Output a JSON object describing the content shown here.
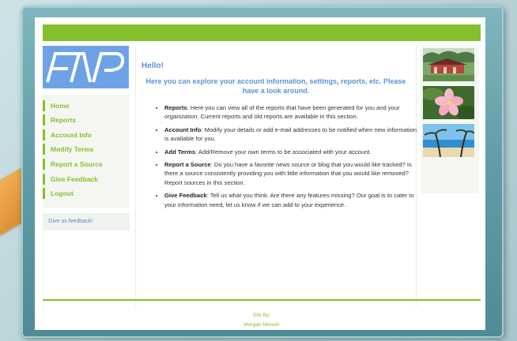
{
  "greeting": "Hello!",
  "intro": "Here you can explore your account information, settings, reports, etc. Please have a look around.",
  "logo_text": "FIP",
  "nav": [
    {
      "label": "Home"
    },
    {
      "label": "Reports"
    },
    {
      "label": "Account Info"
    },
    {
      "label": "Modify Terms"
    },
    {
      "label": "Report a Source"
    },
    {
      "label": "Give Feedback"
    },
    {
      "label": "Logout"
    }
  ],
  "feedback_link": "Give us feedback!",
  "items": [
    {
      "title": "Reports",
      "text": ": Here you can view all of the reports that have been generated for you and your organization. Current reports and old reports are available in this section."
    },
    {
      "title": "Account Info",
      "text": ": Modify your details or add e-mail addresses to be notified when new information is available for you."
    },
    {
      "title": "Add Terms",
      "text": ": Add/Remove your own terms to be associated with your account."
    },
    {
      "title": "Report a Source",
      "text": ": Do you have a favorite news source or blog that you would like tracked? Is there a source consistently providing you with little information that you would like removed? Report sources in this section."
    },
    {
      "title": "Give Feedback",
      "text": ": Tell us what you think. Are there any features missing? Our goal is to cater to your information need, let us know if we can add to your experience."
    }
  ],
  "footer": {
    "site_by": "Site By:",
    "author": "Morgan Nilsson"
  },
  "colors": {
    "accent": "#86bf2c",
    "link_blue": "#5a93d6",
    "logo_blue": "#6da3e6",
    "frame": "#5f9ca6"
  },
  "thumbnails": [
    {
      "name": "temple-photo"
    },
    {
      "name": "flower-photo"
    },
    {
      "name": "beach-photo"
    }
  ]
}
